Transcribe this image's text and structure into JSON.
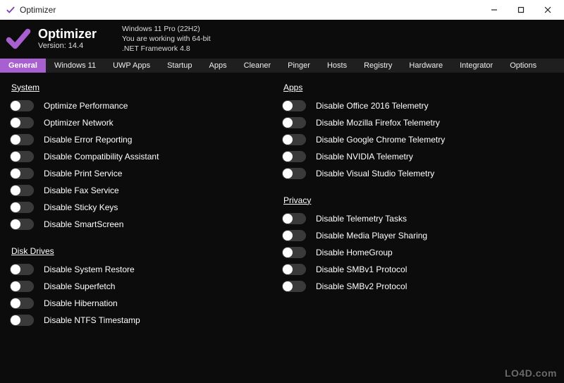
{
  "colors": {
    "accent": "#a85fcf",
    "bg": "#0c0c0c",
    "tabsBg": "#1f1f1f"
  },
  "titlebar": {
    "title": "Optimizer"
  },
  "header": {
    "appName": "Optimizer",
    "version": "Version: 14.4",
    "env1": "Windows 11 Pro (22H2)",
    "env2": "You are working with 64-bit",
    "env3": ".NET Framework 4.8"
  },
  "tabs": [
    {
      "label": "General",
      "active": true
    },
    {
      "label": "Windows 11",
      "active": false
    },
    {
      "label": "UWP Apps",
      "active": false
    },
    {
      "label": "Startup",
      "active": false
    },
    {
      "label": "Apps",
      "active": false
    },
    {
      "label": "Cleaner",
      "active": false
    },
    {
      "label": "Pinger",
      "active": false
    },
    {
      "label": "Hosts",
      "active": false
    },
    {
      "label": "Registry",
      "active": false
    },
    {
      "label": "Hardware",
      "active": false
    },
    {
      "label": "Integrator",
      "active": false
    },
    {
      "label": "Options",
      "active": false
    }
  ],
  "left": {
    "systemTitle": "System",
    "systemItems": [
      {
        "label": "Optimize Performance",
        "on": false
      },
      {
        "label": "Optimizer Network",
        "on": false
      },
      {
        "label": "Disable Error Reporting",
        "on": false
      },
      {
        "label": "Disable Compatibility Assistant",
        "on": false
      },
      {
        "label": "Disable Print Service",
        "on": false
      },
      {
        "label": "Disable Fax Service",
        "on": false
      },
      {
        "label": "Disable Sticky Keys",
        "on": false
      },
      {
        "label": "Disable SmartScreen",
        "on": false
      }
    ],
    "diskTitle": "Disk Drives",
    "diskItems": [
      {
        "label": "Disable System Restore",
        "on": false
      },
      {
        "label": "Disable Superfetch",
        "on": false
      },
      {
        "label": "Disable Hibernation",
        "on": false
      },
      {
        "label": "Disable NTFS Timestamp",
        "on": false
      }
    ]
  },
  "right": {
    "appsTitle": "Apps",
    "appsItems": [
      {
        "label": "Disable Office 2016 Telemetry",
        "on": false
      },
      {
        "label": "Disable Mozilla Firefox Telemetry",
        "on": false
      },
      {
        "label": "Disable Google Chrome Telemetry",
        "on": false
      },
      {
        "label": "Disable NVIDIA Telemetry",
        "on": false
      },
      {
        "label": "Disable Visual Studio Telemetry",
        "on": false
      }
    ],
    "privacyTitle": "Privacy",
    "privacyItems": [
      {
        "label": "Disable Telemetry Tasks",
        "on": false
      },
      {
        "label": "Disable Media Player Sharing",
        "on": false
      },
      {
        "label": "Disable HomeGroup",
        "on": false
      },
      {
        "label": "Disable SMBv1 Protocol",
        "on": false
      },
      {
        "label": "Disable SMBv2 Protocol",
        "on": false
      }
    ]
  },
  "watermark": "LO4D.com"
}
